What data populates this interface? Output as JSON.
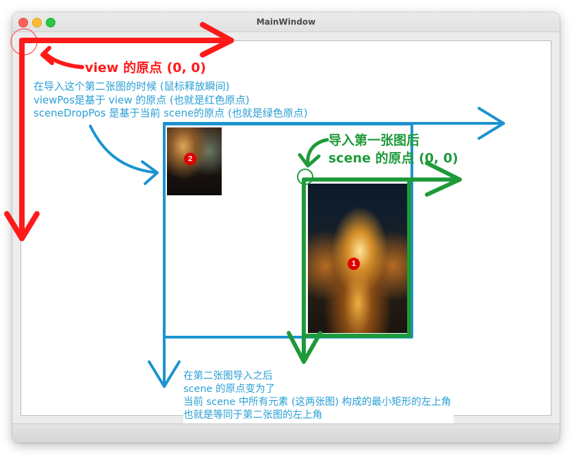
{
  "window": {
    "title": "MainWindow"
  },
  "scene": {
    "images": [
      {
        "badge": "2"
      },
      {
        "badge": "1"
      }
    ]
  },
  "annotations": {
    "view_origin": "view 的原点 (0, 0)",
    "second_image_note": [
      "在导入这个第二张图的时候 (鼠标释放瞬间)",
      "viewPos是基于 view 的原点 (也就是红色原点)",
      "sceneDropPos 是基于当前 scene的原点 (也就是绿色原点)"
    ],
    "scene_origin_after_first": [
      "导入第一张图后",
      "scene 的原点 (0, 0)"
    ],
    "after_second_import": [
      "在第二张图导入之后",
      "scene 的原点变为了",
      "当前 scene 中所有元素 (这两张图) 构成的最小矩形的左上角",
      "也就是等同于第二张图的左上角"
    ]
  },
  "colors": {
    "view_axis": "#ff1a1a",
    "scene_axis_after_first": "#1e9a3a",
    "scene_axis_after_second": "#2a9fd6"
  },
  "icons": {
    "close": "close-icon",
    "minimize": "minimize-icon",
    "maximize": "maximize-icon"
  }
}
